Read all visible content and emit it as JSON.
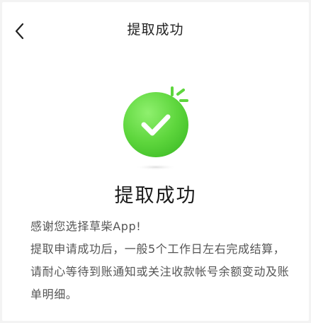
{
  "navbar": {
    "title": "提取成功",
    "back_icon": "chevron-left-icon"
  },
  "result": {
    "icon": "success-check-icon",
    "accent_color": "#5ed63d",
    "heading": "提取成功",
    "message_lines": [
      "感谢您选择草柴App!",
      "提取申请成功后，一般5个工作日左右完成结算，请耐心等待到账通知或关注收款帐号余额变动及账单明细。"
    ]
  }
}
